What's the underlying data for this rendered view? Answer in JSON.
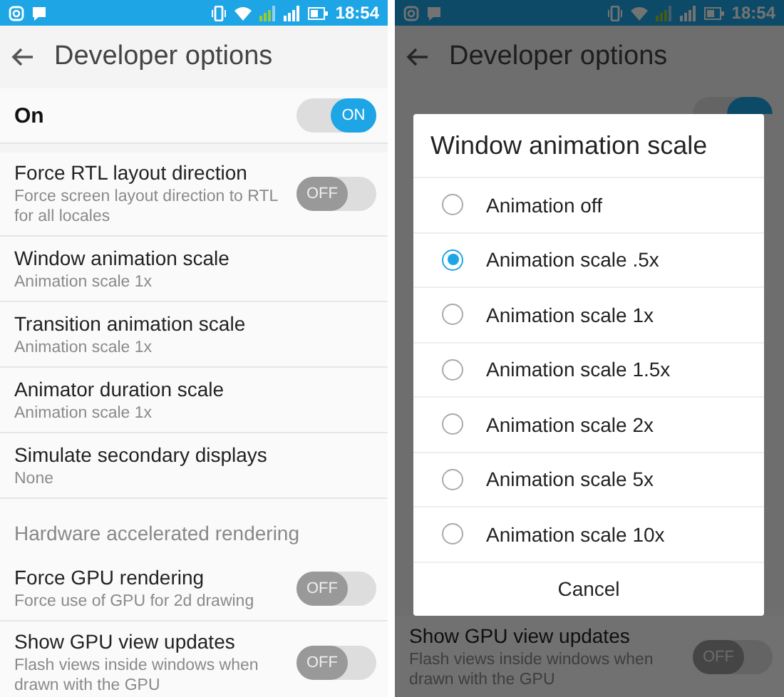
{
  "screens": [
    {
      "status_bar": {
        "time": "18:54"
      },
      "title": "Developer options",
      "master": {
        "label": "On",
        "on": true,
        "switch_text": "ON"
      },
      "items": [
        {
          "kind": "switch",
          "title": "Force RTL layout direction",
          "summary": "Force screen layout direction to RTL for all locales",
          "on": false,
          "switch_text": "OFF"
        },
        {
          "kind": "plain",
          "title": "Window animation scale",
          "summary": "Animation scale 1x"
        },
        {
          "kind": "plain",
          "title": "Transition animation scale",
          "summary": "Animation scale 1x"
        },
        {
          "kind": "plain",
          "title": "Animator duration scale",
          "summary": "Animation scale 1x"
        },
        {
          "kind": "plain",
          "title": "Simulate secondary displays",
          "summary": "None"
        },
        {
          "kind": "header",
          "title": "Hardware accelerated rendering"
        },
        {
          "kind": "switch",
          "title": "Force GPU rendering",
          "summary": "Force use of GPU for 2d drawing",
          "on": false,
          "switch_text": "OFF"
        },
        {
          "kind": "switch",
          "title": "Show GPU view updates",
          "summary": "Flash views inside windows when drawn with the GPU",
          "on": false,
          "switch_text": "OFF"
        }
      ]
    },
    {
      "dimmed": true,
      "status_bar": {
        "time": "18:54"
      },
      "title": "Developer options",
      "master": {
        "on": true
      },
      "dialog": {
        "title": "Window animation scale",
        "options": [
          {
            "label": "Animation off",
            "selected": false
          },
          {
            "label": "Animation scale .5x",
            "selected": true
          },
          {
            "label": "Animation scale 1x",
            "selected": false
          },
          {
            "label": "Animation scale 1.5x",
            "selected": false
          },
          {
            "label": "Animation scale 2x",
            "selected": false
          },
          {
            "label": "Animation scale 5x",
            "selected": false
          },
          {
            "label": "Animation scale 10x",
            "selected": false
          }
        ],
        "button": "Cancel"
      },
      "items": [
        {
          "kind": "switch",
          "title": "Show GPU view updates",
          "summary": "Flash views inside windows when drawn with the GPU",
          "on": false,
          "switch_text": "OFF"
        }
      ]
    }
  ]
}
